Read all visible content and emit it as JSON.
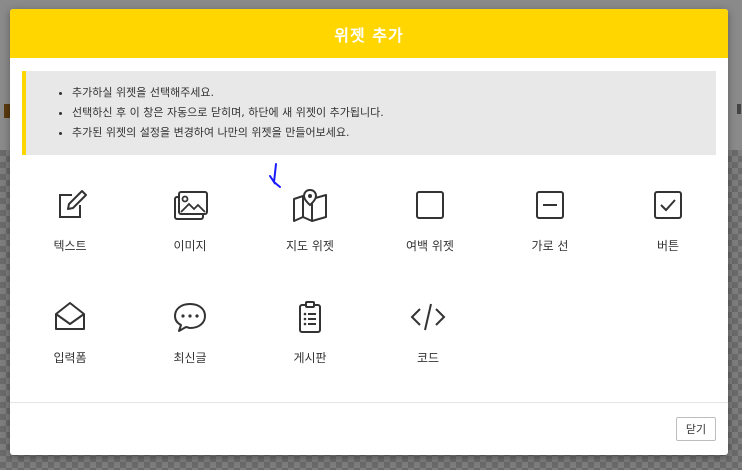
{
  "modal": {
    "title": "위젯 추가",
    "notices": [
      "추가하실 위젯을 선택해주세요.",
      "선택하신 후 이 창은 자동으로 닫히며, 하단에 새 위젯이 추가됩니다.",
      "추가된 위젯의 설정을 변경하여 나만의 위젯을 만들어보세요."
    ],
    "widgets": [
      {
        "label": "텍스트",
        "icon": "edit-icon"
      },
      {
        "label": "이미지",
        "icon": "images-icon"
      },
      {
        "label": "지도 위젯",
        "icon": "map-icon"
      },
      {
        "label": "여백 위젯",
        "icon": "square-icon"
      },
      {
        "label": "가로 선",
        "icon": "minus-square-icon"
      },
      {
        "label": "버튼",
        "icon": "check-square-icon"
      },
      {
        "label": "입력폼",
        "icon": "envelope-open-icon"
      },
      {
        "label": "최신글",
        "icon": "chat-bubble-icon"
      },
      {
        "label": "게시판",
        "icon": "clipboard-list-icon"
      },
      {
        "label": "코드",
        "icon": "code-icon"
      }
    ],
    "close_label": "닫기"
  },
  "colors": {
    "accent": "#ffd600",
    "notice_bg": "#e8e8e8",
    "icon_stroke": "#333333"
  }
}
